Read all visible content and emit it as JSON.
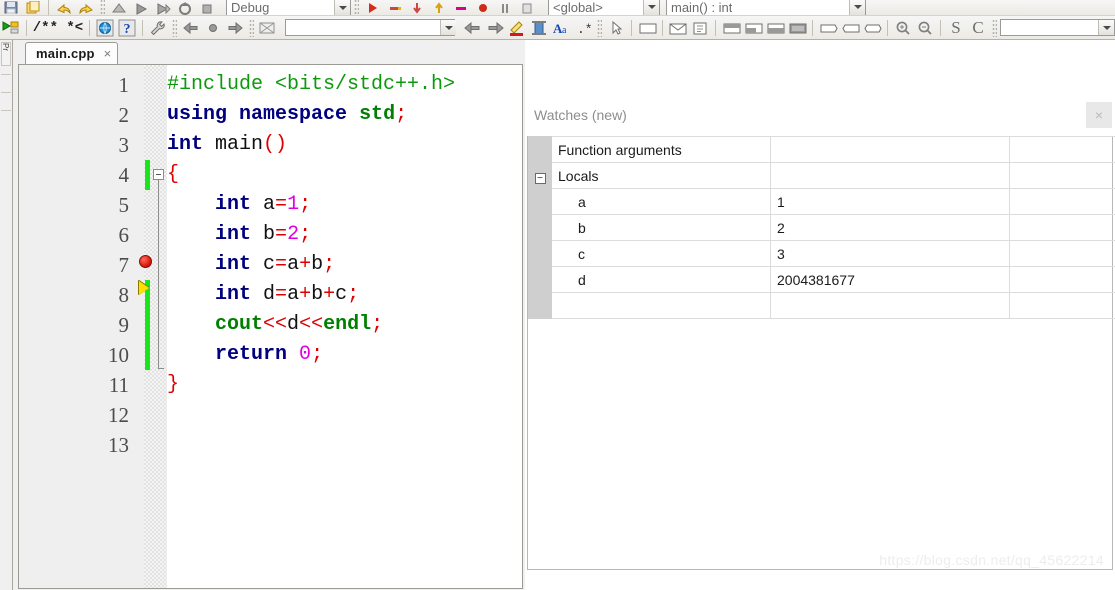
{
  "toolbars": {
    "top_row": {
      "build_target_label": "Debug",
      "scope_label": "<global>",
      "symbol_label": "main() : int",
      "icons": [
        "save-icon",
        "copy-icon",
        "undo-icon",
        "redo-icon",
        "build-icon",
        "run-icon",
        "build-and-run-icon",
        "rebuild-icon",
        "abort-icon",
        "debug-continue-icon",
        "debug-next-line-icon",
        "debug-step-into-icon",
        "debug-step-out-icon",
        "debug-next-instruction-icon",
        "debug-stop-icon"
      ]
    },
    "second_row": {
      "debug_run_label": "",
      "doc_block_label": "/** *<",
      "search_value": "",
      "icons": [
        "debug-run-icon",
        "doc-block-icon",
        "browse-tracker-icon",
        "help-icon",
        "wrench-icon",
        "nav-back-icon",
        "nav-mark-icon",
        "nav-forward-icon",
        "debugger-breakpoint-icon",
        "prev-icon",
        "next-icon",
        "highlight-icon",
        "column-icon",
        "font-icon",
        "regex-icon",
        "pointer-icon",
        "frame-icon",
        "envelope-icon",
        "index-icon",
        "panel-top-icon",
        "panel-left-icon",
        "panel-right-icon",
        "panel-full-icon",
        "box-right-icon",
        "box-left-icon",
        "box-center-icon",
        "zoom-in-icon",
        "zoom-out-icon",
        "spell-s-icon",
        "spell-c-icon"
      ]
    }
  },
  "left_dock": {
    "vertical_tab_label": "Pr"
  },
  "editor": {
    "tab": {
      "filename": "main.cpp",
      "close_glyph": "×"
    },
    "lines": [
      {
        "number": "1",
        "tokens": [
          {
            "t": "#include ",
            "c": "pre"
          },
          {
            "t": "<bits/stdc++.h>",
            "c": "pre"
          }
        ]
      },
      {
        "number": "2",
        "tokens": [
          {
            "t": "using",
            "c": "kw"
          },
          {
            "t": " ",
            "c": "id"
          },
          {
            "t": "namespace",
            "c": "kw"
          },
          {
            "t": " ",
            "c": "id"
          },
          {
            "t": "std",
            "c": "gkw"
          },
          {
            "t": ";",
            "c": "op"
          }
        ]
      },
      {
        "number": "3",
        "tokens": [
          {
            "t": "int",
            "c": "kw"
          },
          {
            "t": " main",
            "c": "fn"
          },
          {
            "t": "()",
            "c": "op"
          }
        ]
      },
      {
        "number": "4",
        "tokens": [
          {
            "t": "{",
            "c": "op"
          }
        ]
      },
      {
        "number": "5",
        "tokens": [
          {
            "t": "    ",
            "c": "id"
          },
          {
            "t": "int",
            "c": "kw"
          },
          {
            "t": " a",
            "c": "id"
          },
          {
            "t": "=",
            "c": "op"
          },
          {
            "t": "1",
            "c": "num"
          },
          {
            "t": ";",
            "c": "op"
          }
        ]
      },
      {
        "number": "6",
        "tokens": [
          {
            "t": "    ",
            "c": "id"
          },
          {
            "t": "int",
            "c": "kw"
          },
          {
            "t": " b",
            "c": "id"
          },
          {
            "t": "=",
            "c": "op"
          },
          {
            "t": "2",
            "c": "num"
          },
          {
            "t": ";",
            "c": "op"
          }
        ]
      },
      {
        "number": "7",
        "tokens": [
          {
            "t": "    ",
            "c": "id"
          },
          {
            "t": "int",
            "c": "kw"
          },
          {
            "t": " c",
            "c": "id"
          },
          {
            "t": "=",
            "c": "op"
          },
          {
            "t": "a",
            "c": "id"
          },
          {
            "t": "+",
            "c": "op"
          },
          {
            "t": "b",
            "c": "id"
          },
          {
            "t": ";",
            "c": "op"
          }
        ]
      },
      {
        "number": "8",
        "tokens": [
          {
            "t": "    ",
            "c": "id"
          },
          {
            "t": "int",
            "c": "kw"
          },
          {
            "t": " d",
            "c": "id"
          },
          {
            "t": "=",
            "c": "op"
          },
          {
            "t": "a",
            "c": "id"
          },
          {
            "t": "+",
            "c": "op"
          },
          {
            "t": "b",
            "c": "id"
          },
          {
            "t": "+",
            "c": "op"
          },
          {
            "t": "c",
            "c": "id"
          },
          {
            "t": ";",
            "c": "op"
          }
        ]
      },
      {
        "number": "9",
        "tokens": [
          {
            "t": "    ",
            "c": "id"
          },
          {
            "t": "cout",
            "c": "gkw"
          },
          {
            "t": "<<",
            "c": "op"
          },
          {
            "t": "d",
            "c": "id"
          },
          {
            "t": "<<",
            "c": "op"
          },
          {
            "t": "endl",
            "c": "gkw"
          },
          {
            "t": ";",
            "c": "op"
          }
        ]
      },
      {
        "number": "10",
        "tokens": [
          {
            "t": "    ",
            "c": "id"
          },
          {
            "t": "return",
            "c": "kw"
          },
          {
            "t": " ",
            "c": "id"
          },
          {
            "t": "0",
            "c": "num"
          },
          {
            "t": ";",
            "c": "op"
          }
        ]
      },
      {
        "number": "11",
        "tokens": [
          {
            "t": "}",
            "c": "op"
          }
        ]
      },
      {
        "number": "12",
        "tokens": []
      },
      {
        "number": "13",
        "tokens": []
      }
    ],
    "markers": {
      "breakpoint_line": "7",
      "current_line_arrow": "8",
      "fold_open_line": "4",
      "changed_lines": [
        "4",
        "8",
        "9"
      ]
    }
  },
  "watches": {
    "title": "Watches (new)",
    "close_glyph": "×",
    "rows": [
      {
        "expander": "",
        "name": "Function arguments",
        "value": "",
        "extra": "",
        "indent": false,
        "changed": false
      },
      {
        "expander": "−",
        "name": "Locals",
        "value": "",
        "extra": "",
        "indent": false,
        "changed": false
      },
      {
        "expander": "",
        "name": "a",
        "value": "1",
        "extra": "",
        "indent": true,
        "changed": false
      },
      {
        "expander": "",
        "name": "b",
        "value": "2",
        "extra": "",
        "indent": true,
        "changed": false
      },
      {
        "expander": "",
        "name": "c",
        "value": "3",
        "extra": "",
        "indent": true,
        "changed": true
      },
      {
        "expander": "",
        "name": "d",
        "value": "2004381677",
        "extra": "",
        "indent": true,
        "changed": false
      },
      {
        "expander": "",
        "name": "",
        "value": "",
        "extra": "",
        "indent": false,
        "changed": false
      }
    ]
  },
  "watermark": "https://blog.csdn.net/qq_45622214",
  "colors": {
    "keyword": "#00007f",
    "preprocessor": "#0c9a0c",
    "number": "#e000e0",
    "operator": "#dd0000",
    "std_symbol": "#008000",
    "breakpoint": "#d81b0e",
    "pc_arrow": "#ffe000",
    "change_bar": "#19e619",
    "changed_value": "#e02020"
  }
}
